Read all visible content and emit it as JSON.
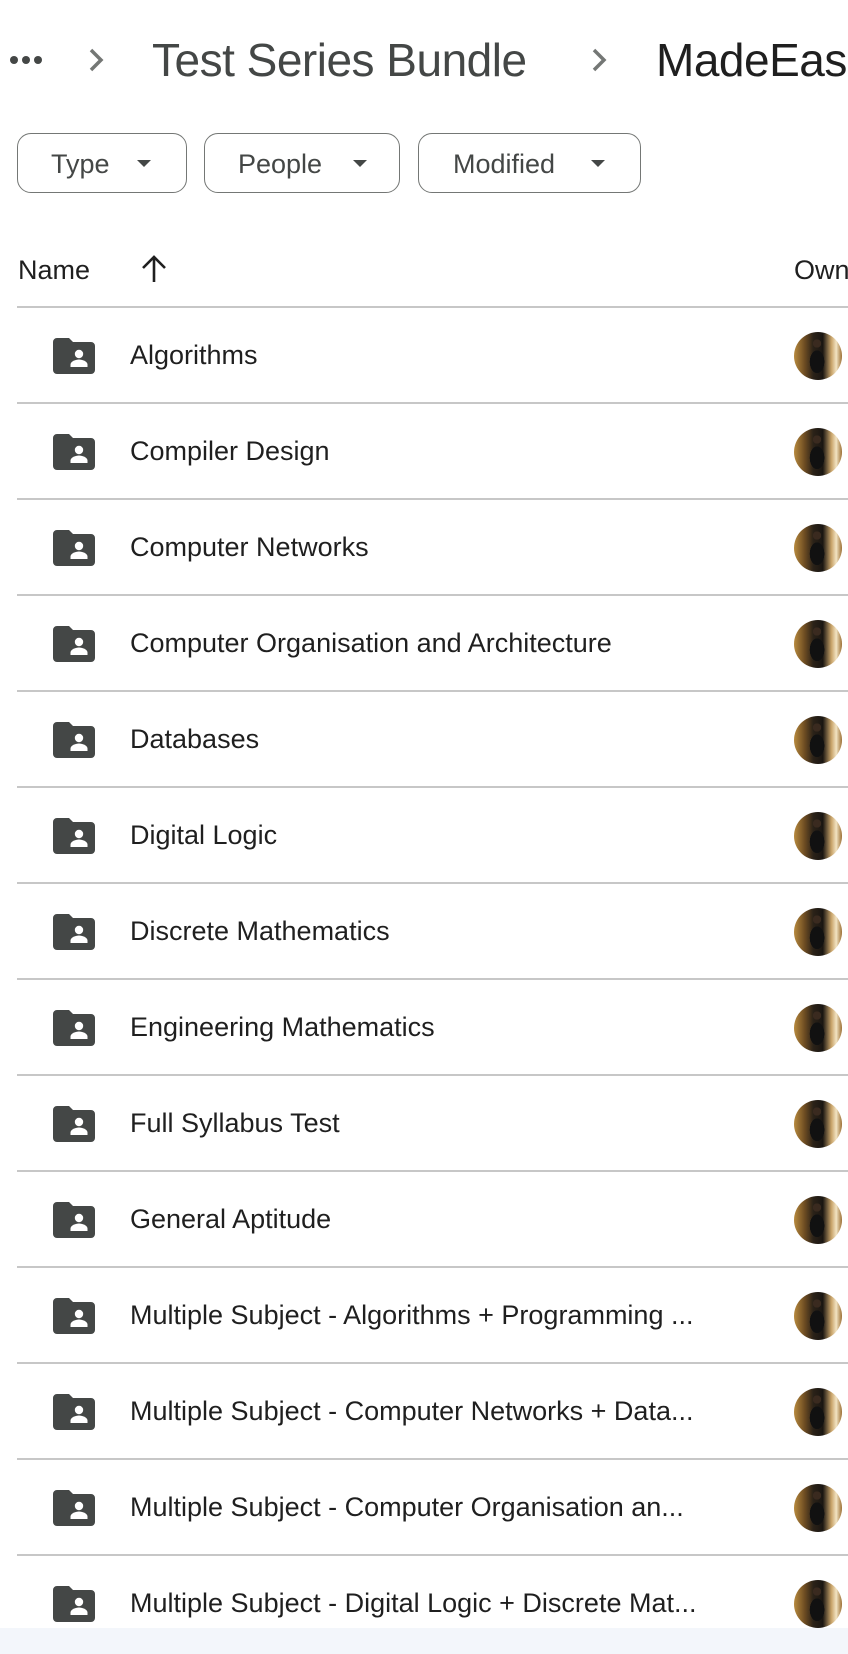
{
  "breadcrumb": {
    "more_icon": "more-horiz-icon",
    "separator_icon": "chevron-right-icon",
    "parent": "Test Series Bundle",
    "current": "MadeEas"
  },
  "filters": [
    {
      "label": "Type",
      "icon": "arrow-drop-down-icon"
    },
    {
      "label": "People",
      "icon": "arrow-drop-down-icon"
    },
    {
      "label": "Modified",
      "icon": "arrow-drop-down-icon"
    }
  ],
  "columns": {
    "name": "Name",
    "sort_icon": "arrow-upward-icon",
    "sort_direction": "ascending",
    "owner": "Own"
  },
  "items": [
    {
      "name": "Algorithms",
      "icon": "shared-folder-icon",
      "owner_avatar": "owner-avatar"
    },
    {
      "name": "Compiler Design",
      "icon": "shared-folder-icon",
      "owner_avatar": "owner-avatar"
    },
    {
      "name": "Computer Networks",
      "icon": "shared-folder-icon",
      "owner_avatar": "owner-avatar"
    },
    {
      "name": "Computer Organisation and Architecture",
      "icon": "shared-folder-icon",
      "owner_avatar": "owner-avatar"
    },
    {
      "name": "Databases",
      "icon": "shared-folder-icon",
      "owner_avatar": "owner-avatar"
    },
    {
      "name": "Digital Logic",
      "icon": "shared-folder-icon",
      "owner_avatar": "owner-avatar"
    },
    {
      "name": "Discrete Mathematics",
      "icon": "shared-folder-icon",
      "owner_avatar": "owner-avatar"
    },
    {
      "name": "Engineering Mathematics",
      "icon": "shared-folder-icon",
      "owner_avatar": "owner-avatar"
    },
    {
      "name": "Full Syllabus Test",
      "icon": "shared-folder-icon",
      "owner_avatar": "owner-avatar"
    },
    {
      "name": "General Aptitude",
      "icon": "shared-folder-icon",
      "owner_avatar": "owner-avatar"
    },
    {
      "name": "Multiple Subject - Algorithms + Programming ...",
      "icon": "shared-folder-icon",
      "owner_avatar": "owner-avatar"
    },
    {
      "name": "Multiple Subject - Computer Networks + Data...",
      "icon": "shared-folder-icon",
      "owner_avatar": "owner-avatar"
    },
    {
      "name": "Multiple Subject - Computer Organisation an...",
      "icon": "shared-folder-icon",
      "owner_avatar": "owner-avatar"
    },
    {
      "name": "Multiple Subject - Digital Logic + Discrete Mat...",
      "icon": "shared-folder-icon",
      "owner_avatar": "owner-avatar"
    }
  ],
  "colors": {
    "text_primary": "#1f1f1f",
    "text_secondary": "#444746",
    "divider": "#c7c7c7",
    "chip_border": "#747775",
    "folder_icon": "#444746",
    "bottom_bar": "#f3f6fb"
  }
}
